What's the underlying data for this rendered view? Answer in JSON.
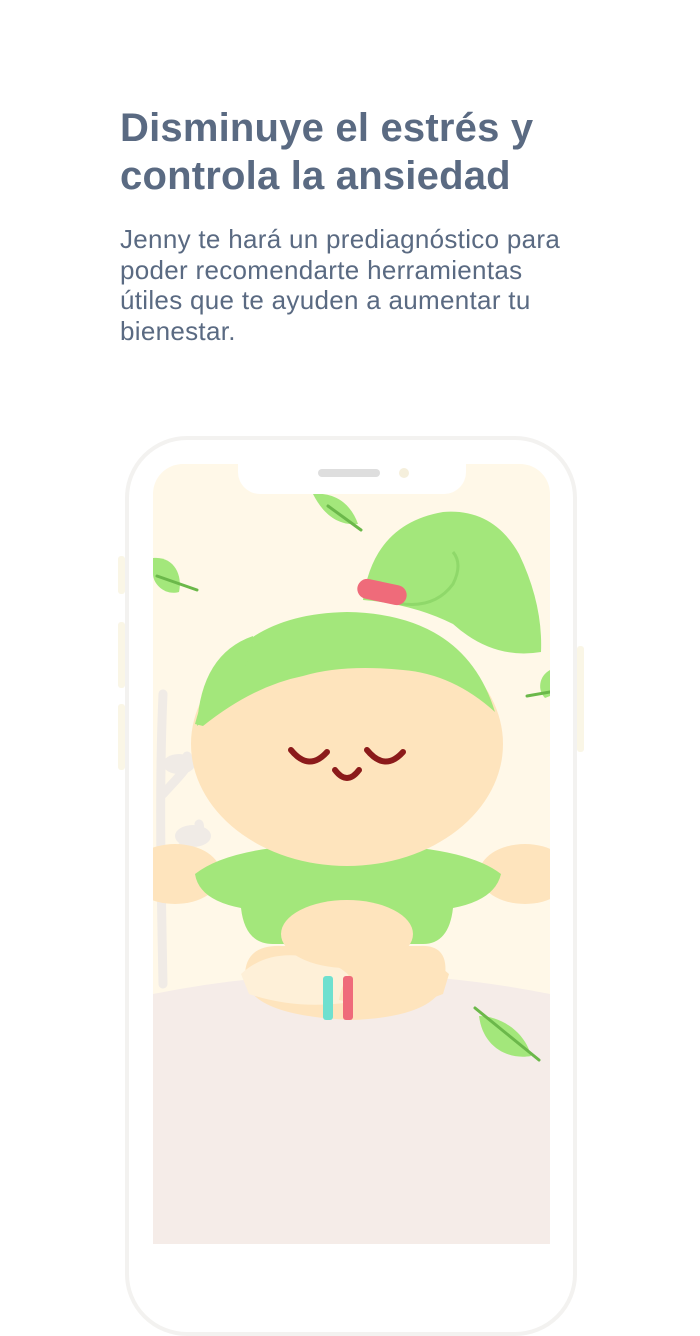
{
  "headline": "Disminuye el estrés y controla la ansiedad",
  "subtitle": "Jenny te hará un prediagnóstico para poder recomendarte herramientas útiles que te ayuden a aumentar tu bienestar.",
  "illustration": {
    "character_name": "Jenny",
    "icons": [
      "phone-frame-icon",
      "leaf-icon",
      "meditating-character-icon",
      "plant-icon"
    ]
  },
  "colors": {
    "text": "#5a6a82",
    "screen_background": "#fff8e8",
    "ground": "#f5ece8",
    "hair_green": "#a3e77b",
    "skin": "#fee4bd",
    "face_lines": "#8b1a1a",
    "hair_tie": "#ef6b7a"
  }
}
